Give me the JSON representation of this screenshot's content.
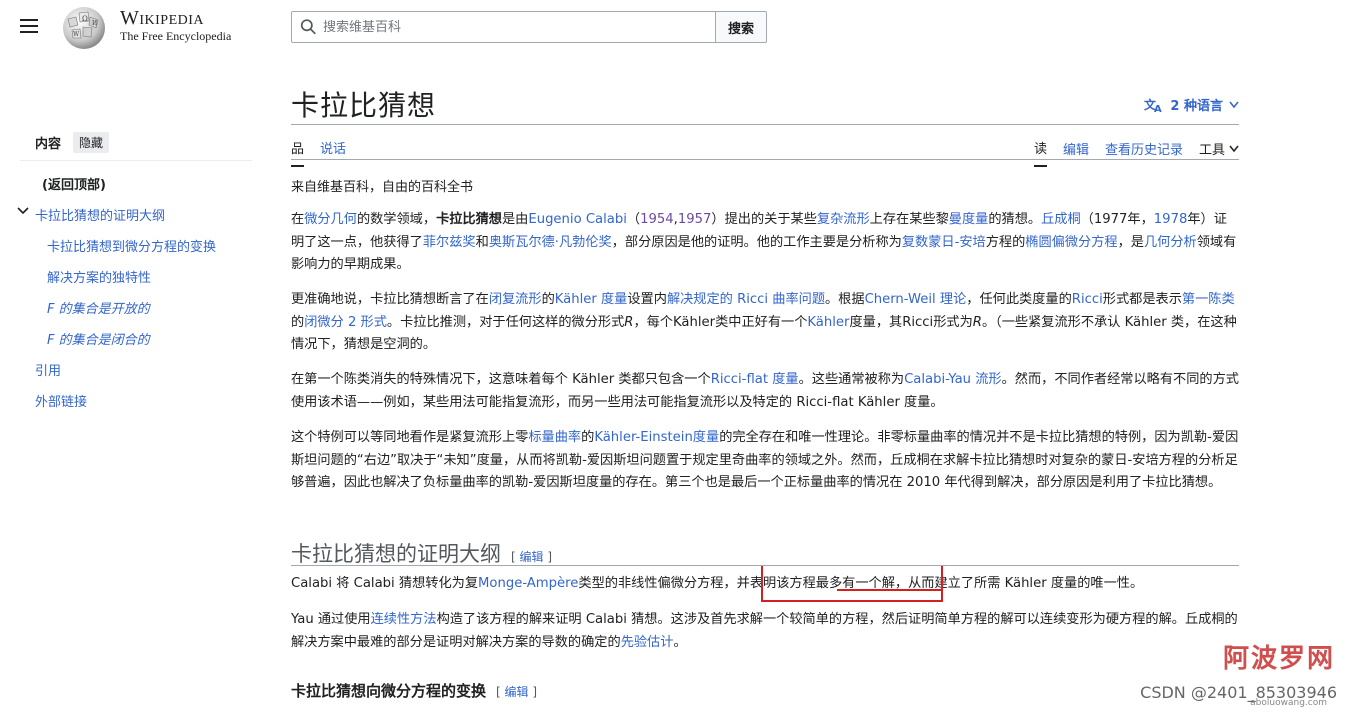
{
  "header": {
    "wordmark_title": "Wikipedia",
    "wordmark_tagline": "The Free Encyclopedia",
    "search_placeholder": "搜索维基百科",
    "search_button": "搜索"
  },
  "toc": {
    "title": "内容",
    "hide": "隐藏",
    "items": [
      {
        "label": "(返回顶部)"
      },
      {
        "label": "卡拉比猜想的证明大纲"
      },
      {
        "label": "卡拉比猜想到微分方程的变换"
      },
      {
        "label": "解决方案的独特性"
      },
      {
        "label": "F 的集合是开放的"
      },
      {
        "label": "F 的集合是闭合的"
      },
      {
        "label": "引用"
      },
      {
        "label": "外部链接"
      }
    ]
  },
  "article": {
    "title": "卡拉比猜想",
    "languages": "2 种语言",
    "tabs_left": [
      "品",
      "说话"
    ],
    "tabs_right": [
      "读",
      "编辑",
      "查看历史记录",
      "工具"
    ],
    "tagline": "来自维基百科，自由的百科全书",
    "p1": {
      "t1": "在",
      "l1": "微分几何",
      "t2": "的数学领域，",
      "b1": "卡拉比猜想",
      "t3": "是由",
      "l2": "Eugenio Calabi",
      "t4": "（",
      "l3": "1954",
      "t5": ",",
      "l4": "1957",
      "t6": "）提出的关于某些",
      "l5": "复杂流形",
      "t7": "上存在某些黎",
      "l6": "曼度量",
      "t8": "的猜想。",
      "l7": "丘成桐",
      "t9": "（1977年，",
      "l8": "1978",
      "t10": "年）证明了这一点，他获得了",
      "l9": "菲尔兹奖",
      "t11": "和",
      "l10": "奥斯瓦尔德·凡勃伦奖",
      "t12": "，部分原因是他的证明。他的工作主要是分析称为",
      "l11": "复数蒙日-安培",
      "t13": "方程的",
      "l12": "椭圆偏微分方程",
      "t14": "，是",
      "l13": "几何分析",
      "t15": "领域有影响力的早期成果。"
    },
    "p2": {
      "t1": "更准确地说，卡拉比猜想断言了在",
      "l1": "闭复流形",
      "t2": "的",
      "l2": "Kähler 度量",
      "t3": "设置内",
      "l3": "解决规定的 Ricci 曲率问题",
      "t4": "。根据",
      "l4": "Chern-Weil 理论",
      "t5": "，任何此类度量的",
      "l5": "Ricci",
      "t6": "形式都是表示",
      "l6": "第一陈类",
      "t7": "的",
      "l7": "闭微分 2 形式",
      "t8": "。卡拉比推测，对于任何这样的微分形式",
      "i1": "R",
      "t9": "，每个Kähler类中正好有一个",
      "l8": "Kähler",
      "t10": "度量，其Ricci形式为",
      "i2": "R",
      "t11": "。（一些紧复流形不承认 Kähler 类，在这种情况下，猜想是空洞的。"
    },
    "p3": {
      "t1": "在第一个陈类消失的特殊情况下，这意味着每个 Kähler 类都只包含一个",
      "l1": "Ricci-flat 度量",
      "t2": "。这些通常被称为",
      "l2": "Calabi-Yau 流形",
      "t3": "。然而，不同作者经常以略有不同的方式使用该术语——例如，某些用法可能指复流形，而另一些用法可能指复流形以及特定的 Ricci-flat Kähler 度量。"
    },
    "p4": {
      "t1": "这个特例可以等同地看作是紧复流形上零",
      "l1": "标量曲率",
      "t2": "的",
      "l2": "Kähler-Einstein度量",
      "t3": "的完全存在和唯一性理论。非零标量曲率的情况并不是卡拉比猜想的特例，因为凯勒-爱因斯坦问题的“右边”取决于“未知”度量，从而将凯勒-爱因斯坦问题置于规定里奇曲率的领域之外。然而，丘成桐在求解卡拉比猜想时对复杂的蒙日-安培方程的分析足够普遍，因此也解决了负标量曲率的凯勒-爱因斯坦度量的存在。第三个也是最后一个正标量曲率的情况在 2010 年代得到解决，部分原因是利用了卡拉比猜想。"
    },
    "h2": "卡拉比猜想的证明大纲",
    "edit_label": "编辑",
    "p5": {
      "t1": "Calabi 将 Calabi 猜想转化为复",
      "l1": "Monge-Ampère",
      "t2": "类型的非线性偏微分方程，",
      "t3": "并表明该方程最多有一个解",
      "t4": "，从而建立了所需 Kähler 度量的唯一性。"
    },
    "p6": {
      "t1": "Yau 通过使用",
      "l1": "连续性方法",
      "t2": "构造了该方程的解来证明 Calabi 猜想。这涉及首先求解一个较简单的方程，然后证明简单方程的解可以连续变形为硬方程的解。丘成桐的解决方案中最难的部分是证明对解决方案的导数的确定的",
      "l2": "先验估计",
      "t3": "。"
    },
    "h3": "卡拉比猜想向微分方程的变换"
  },
  "watermark": {
    "cn": "阿波罗网",
    "csdn": "CSDN @2401_85303946",
    "url": "aboluowang.com"
  },
  "colors": {
    "link": "#3366cc",
    "visited": "#6b4ba1",
    "annotation": "#d42020"
  }
}
